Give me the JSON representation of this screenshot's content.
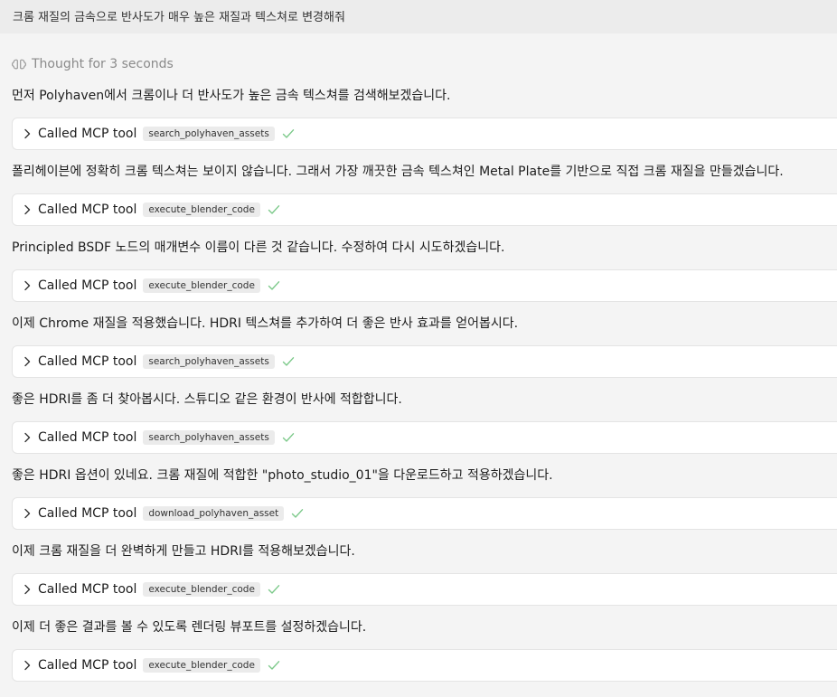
{
  "user_prompt": "크롬 재질의 금속으로 반사도가 매우 높은 재질과 텍스쳐로 변경해줘",
  "thought_label": "Thought for 3 seconds",
  "tool_call_label": "Called MCP tool",
  "colors": {
    "page_bg": "#f4f4f4",
    "user_bubble_bg": "#ececec",
    "card_bg": "#ffffff",
    "check_green": "#7cc98a",
    "muted_text": "#8a8a8a"
  },
  "steps": [
    {
      "text": "먼저 Polyhaven에서 크롬이나 더 반사도가 높은 금속 텍스쳐를 검색해보겠습니다.",
      "tool": "search_polyhaven_assets",
      "status": "success"
    },
    {
      "text": "폴리헤이븐에 정확히 크롬 텍스쳐는 보이지 않습니다. 그래서 가장 깨끗한 금속 텍스쳐인 Metal Plate를 기반으로 직접 크롬 재질을 만들겠습니다.",
      "tool": "execute_blender_code",
      "status": "success"
    },
    {
      "text": "Principled BSDF 노드의 매개변수 이름이 다른 것 같습니다. 수정하여 다시 시도하겠습니다.",
      "tool": "execute_blender_code",
      "status": "success"
    },
    {
      "text": "이제 Chrome 재질을 적용했습니다. HDRI 텍스쳐를 추가하여 더 좋은 반사 효과를 얻어봅시다.",
      "tool": "search_polyhaven_assets",
      "status": "success"
    },
    {
      "text": "좋은 HDRI를 좀 더 찾아봅시다. 스튜디오 같은 환경이 반사에 적합합니다.",
      "tool": "search_polyhaven_assets",
      "status": "success"
    },
    {
      "text": "좋은 HDRI 옵션이 있네요. 크롬 재질에 적합한 \"photo_studio_01\"을 다운로드하고 적용하겠습니다.",
      "tool": "download_polyhaven_asset",
      "status": "success"
    },
    {
      "text": "이제 크롬 재질을 더 완벽하게 만들고 HDRI를 적용해보겠습니다.",
      "tool": "execute_blender_code",
      "status": "success"
    },
    {
      "text": "이제 더 좋은 결과를 볼 수 있도록 렌더링 뷰포트를 설정하겠습니다.",
      "tool": "execute_blender_code",
      "status": "success"
    }
  ]
}
